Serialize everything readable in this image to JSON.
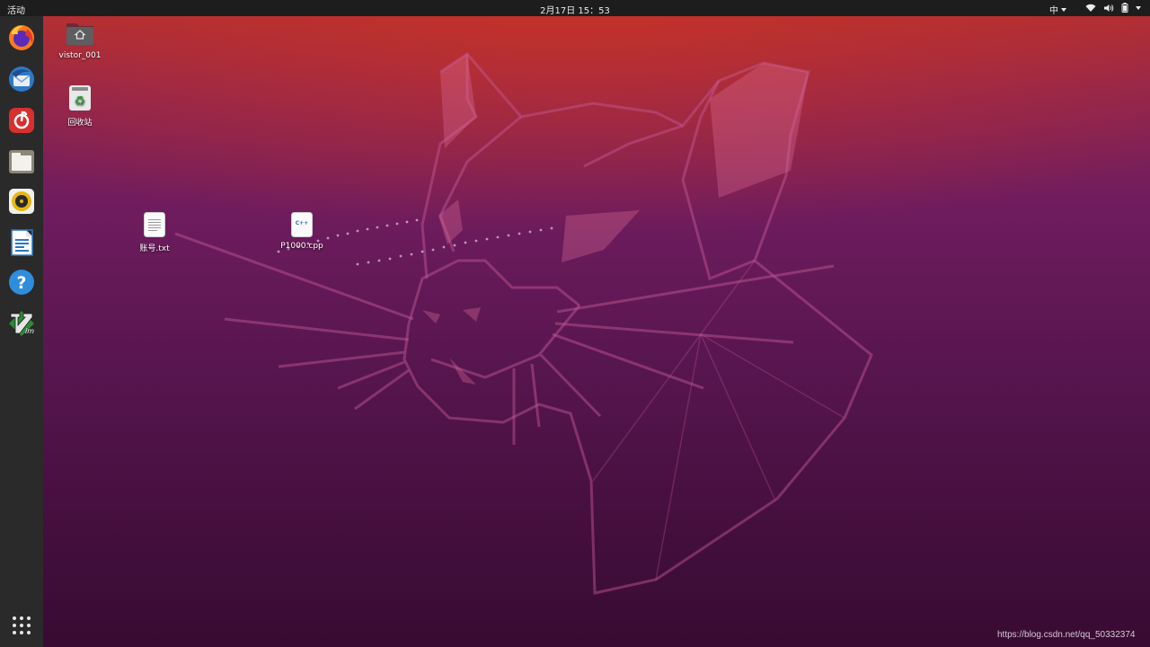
{
  "topbar": {
    "activities": "活动",
    "clock": "2月17日 15：53",
    "input_method": "中"
  },
  "tray_icons": [
    "network-icon",
    "volume-icon",
    "battery-icon",
    "system-menu-caret-icon"
  ],
  "dock": {
    "items": [
      {
        "name": "firefox",
        "icon": "firefox-icon"
      },
      {
        "name": "thunderbird",
        "icon": "thunderbird-icon"
      },
      {
        "name": "netease-music",
        "icon": "music-icon"
      },
      {
        "name": "files",
        "icon": "files-icon"
      },
      {
        "name": "rhythmbox",
        "icon": "rhythmbox-icon"
      },
      {
        "name": "libreoffice-writer",
        "icon": "writer-icon"
      },
      {
        "name": "help",
        "icon": "help-icon"
      },
      {
        "name": "vim",
        "icon": "vim-icon"
      }
    ],
    "show_apps": "grid-icon"
  },
  "desktop": {
    "icons": [
      {
        "label": "vistor_001",
        "icon": "home-folder-icon"
      },
      {
        "label": "回收站",
        "icon": "trash-icon"
      },
      {
        "label": "账号.txt",
        "icon": "text-file-icon"
      },
      {
        "label": "P1000.cpp",
        "icon": "cpp-file-icon",
        "badge": "C++"
      }
    ]
  },
  "watermark": "https://blog.csdn.net/qq_50332374",
  "colors": {
    "topbar": "#1d1d1d",
    "dock": "#2a2a2a",
    "wallpaper_top": "#b23030",
    "wallpaper_bottom": "#380b33"
  }
}
